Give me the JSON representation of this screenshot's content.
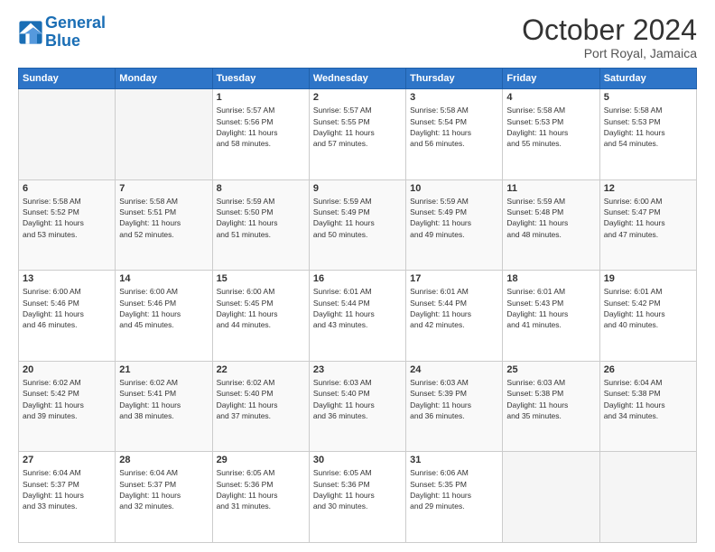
{
  "logo": {
    "line1": "General",
    "line2": "Blue"
  },
  "title": "October 2024",
  "location": "Port Royal, Jamaica",
  "days_header": [
    "Sunday",
    "Monday",
    "Tuesday",
    "Wednesday",
    "Thursday",
    "Friday",
    "Saturday"
  ],
  "weeks": [
    [
      {
        "day": "",
        "info": ""
      },
      {
        "day": "",
        "info": ""
      },
      {
        "day": "1",
        "info": "Sunrise: 5:57 AM\nSunset: 5:56 PM\nDaylight: 11 hours\nand 58 minutes."
      },
      {
        "day": "2",
        "info": "Sunrise: 5:57 AM\nSunset: 5:55 PM\nDaylight: 11 hours\nand 57 minutes."
      },
      {
        "day": "3",
        "info": "Sunrise: 5:58 AM\nSunset: 5:54 PM\nDaylight: 11 hours\nand 56 minutes."
      },
      {
        "day": "4",
        "info": "Sunrise: 5:58 AM\nSunset: 5:53 PM\nDaylight: 11 hours\nand 55 minutes."
      },
      {
        "day": "5",
        "info": "Sunrise: 5:58 AM\nSunset: 5:53 PM\nDaylight: 11 hours\nand 54 minutes."
      }
    ],
    [
      {
        "day": "6",
        "info": "Sunrise: 5:58 AM\nSunset: 5:52 PM\nDaylight: 11 hours\nand 53 minutes."
      },
      {
        "day": "7",
        "info": "Sunrise: 5:58 AM\nSunset: 5:51 PM\nDaylight: 11 hours\nand 52 minutes."
      },
      {
        "day": "8",
        "info": "Sunrise: 5:59 AM\nSunset: 5:50 PM\nDaylight: 11 hours\nand 51 minutes."
      },
      {
        "day": "9",
        "info": "Sunrise: 5:59 AM\nSunset: 5:49 PM\nDaylight: 11 hours\nand 50 minutes."
      },
      {
        "day": "10",
        "info": "Sunrise: 5:59 AM\nSunset: 5:49 PM\nDaylight: 11 hours\nand 49 minutes."
      },
      {
        "day": "11",
        "info": "Sunrise: 5:59 AM\nSunset: 5:48 PM\nDaylight: 11 hours\nand 48 minutes."
      },
      {
        "day": "12",
        "info": "Sunrise: 6:00 AM\nSunset: 5:47 PM\nDaylight: 11 hours\nand 47 minutes."
      }
    ],
    [
      {
        "day": "13",
        "info": "Sunrise: 6:00 AM\nSunset: 5:46 PM\nDaylight: 11 hours\nand 46 minutes."
      },
      {
        "day": "14",
        "info": "Sunrise: 6:00 AM\nSunset: 5:46 PM\nDaylight: 11 hours\nand 45 minutes."
      },
      {
        "day": "15",
        "info": "Sunrise: 6:00 AM\nSunset: 5:45 PM\nDaylight: 11 hours\nand 44 minutes."
      },
      {
        "day": "16",
        "info": "Sunrise: 6:01 AM\nSunset: 5:44 PM\nDaylight: 11 hours\nand 43 minutes."
      },
      {
        "day": "17",
        "info": "Sunrise: 6:01 AM\nSunset: 5:44 PM\nDaylight: 11 hours\nand 42 minutes."
      },
      {
        "day": "18",
        "info": "Sunrise: 6:01 AM\nSunset: 5:43 PM\nDaylight: 11 hours\nand 41 minutes."
      },
      {
        "day": "19",
        "info": "Sunrise: 6:01 AM\nSunset: 5:42 PM\nDaylight: 11 hours\nand 40 minutes."
      }
    ],
    [
      {
        "day": "20",
        "info": "Sunrise: 6:02 AM\nSunset: 5:42 PM\nDaylight: 11 hours\nand 39 minutes."
      },
      {
        "day": "21",
        "info": "Sunrise: 6:02 AM\nSunset: 5:41 PM\nDaylight: 11 hours\nand 38 minutes."
      },
      {
        "day": "22",
        "info": "Sunrise: 6:02 AM\nSunset: 5:40 PM\nDaylight: 11 hours\nand 37 minutes."
      },
      {
        "day": "23",
        "info": "Sunrise: 6:03 AM\nSunset: 5:40 PM\nDaylight: 11 hours\nand 36 minutes."
      },
      {
        "day": "24",
        "info": "Sunrise: 6:03 AM\nSunset: 5:39 PM\nDaylight: 11 hours\nand 36 minutes."
      },
      {
        "day": "25",
        "info": "Sunrise: 6:03 AM\nSunset: 5:38 PM\nDaylight: 11 hours\nand 35 minutes."
      },
      {
        "day": "26",
        "info": "Sunrise: 6:04 AM\nSunset: 5:38 PM\nDaylight: 11 hours\nand 34 minutes."
      }
    ],
    [
      {
        "day": "27",
        "info": "Sunrise: 6:04 AM\nSunset: 5:37 PM\nDaylight: 11 hours\nand 33 minutes."
      },
      {
        "day": "28",
        "info": "Sunrise: 6:04 AM\nSunset: 5:37 PM\nDaylight: 11 hours\nand 32 minutes."
      },
      {
        "day": "29",
        "info": "Sunrise: 6:05 AM\nSunset: 5:36 PM\nDaylight: 11 hours\nand 31 minutes."
      },
      {
        "day": "30",
        "info": "Sunrise: 6:05 AM\nSunset: 5:36 PM\nDaylight: 11 hours\nand 30 minutes."
      },
      {
        "day": "31",
        "info": "Sunrise: 6:06 AM\nSunset: 5:35 PM\nDaylight: 11 hours\nand 29 minutes."
      },
      {
        "day": "",
        "info": ""
      },
      {
        "day": "",
        "info": ""
      }
    ]
  ]
}
